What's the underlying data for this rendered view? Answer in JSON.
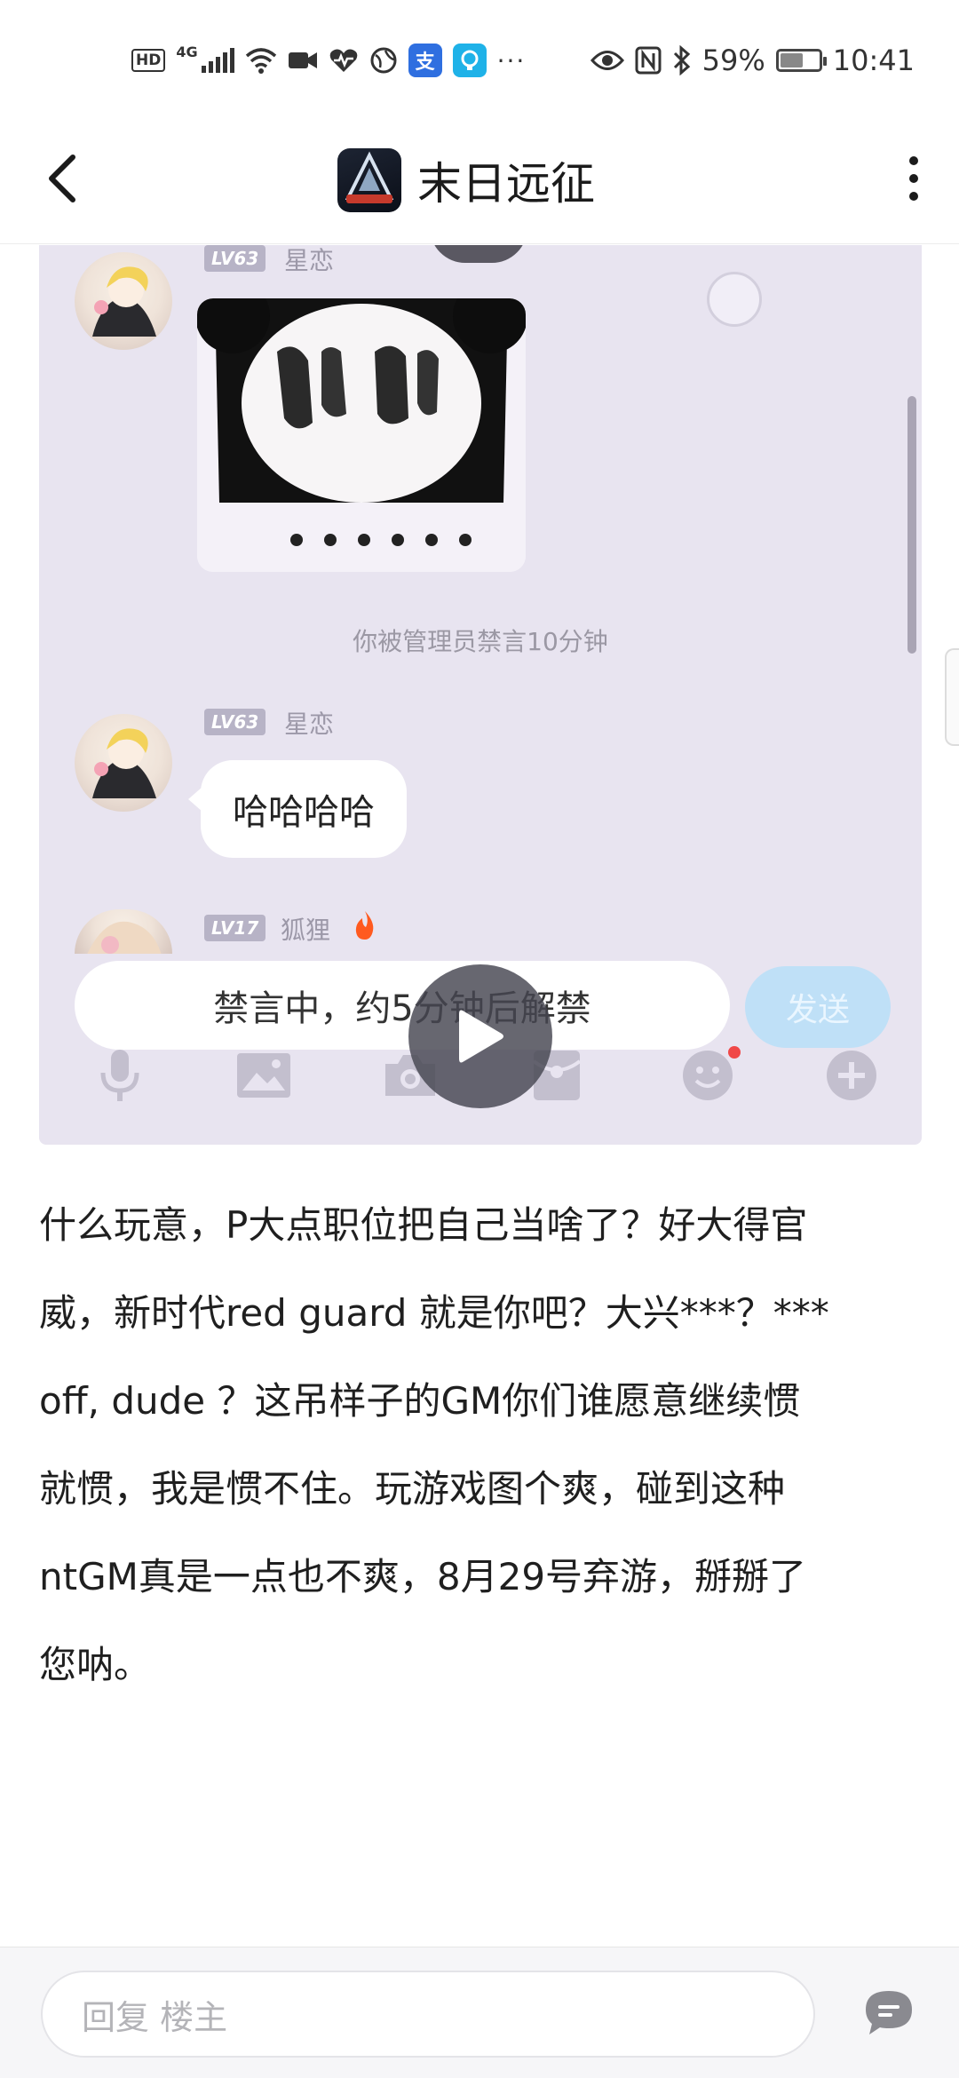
{
  "status_bar": {
    "network_badge": "HD",
    "network_type": "4G",
    "more": "···",
    "battery_percent": "59%",
    "time": "10:41",
    "battery_level": 0.59
  },
  "header": {
    "title": "末日远征",
    "back_icon": "chevron-left-icon",
    "more_icon": "more-vertical-icon"
  },
  "chat_screenshot": {
    "messages": [
      {
        "level": "LV63",
        "nickname": "星恋",
        "type": "sticker"
      },
      {
        "type": "system",
        "text": "你被管理员禁言10分钟"
      },
      {
        "level": "LV63",
        "nickname": "星恋",
        "type": "text",
        "text": "哈哈哈哈"
      },
      {
        "level": "LV17",
        "nickname": "狐狸",
        "type": "partial"
      }
    ],
    "mute_notice": "禁言中，约5分钟后解禁",
    "send_label": "发送",
    "toolbar_icons": [
      "microphone-icon",
      "image-icon",
      "camera-icon",
      "red-packet-icon",
      "emoji-icon",
      "plus-icon"
    ]
  },
  "post": {
    "lines": [
      "什么玩意，P大点职位把自己当啥了？好大得官",
      "威，新时代red guard 就是你吧？大兴***？***",
      "off, dude ？这吊样子的GM你们谁愿意继续惯",
      "就惯，我是惯不住。玩游戏图个爽，碰到这种",
      "ntGM真是一点也不爽，8月29号弃游，掰掰了",
      "您呐。"
    ]
  },
  "reply_bar": {
    "placeholder": "回复  楼主"
  },
  "colors": {
    "chat_background": "#e8e4f0",
    "send_button": "#bfe0f7",
    "level_badge": "#b7b3c6"
  }
}
